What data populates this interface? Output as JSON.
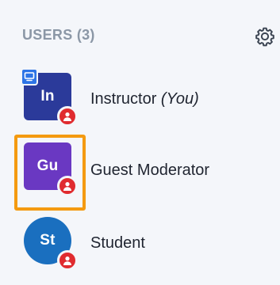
{
  "header": {
    "title": "USERS (3)",
    "settings_icon": "gear-icon"
  },
  "users": [
    {
      "initials": "In",
      "name": "Instructor",
      "you_suffix": "(You)",
      "avatar_shape": "square",
      "avatar_color": "#2b3a9a",
      "is_presenter": true,
      "is_moderator": true
    },
    {
      "initials": "Gu",
      "name": "Guest Moderator",
      "avatar_shape": "square",
      "avatar_color": "#6a38c2",
      "is_moderator": true,
      "highlighted": true
    },
    {
      "initials": "St",
      "name": "Student",
      "avatar_shape": "circle",
      "avatar_color": "#1a6fbf",
      "is_moderator": true
    }
  ],
  "colors": {
    "header_text": "#8b97a6",
    "highlight_outline": "#f49a10",
    "moderator_badge": "#e02b2f",
    "presenter_badge": "#2d74e6",
    "background": "#f4f6fa"
  }
}
